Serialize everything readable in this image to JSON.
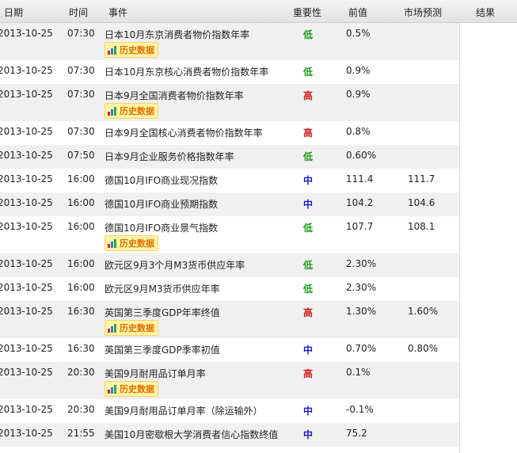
{
  "header": {
    "date": "日期",
    "time": "时间",
    "event": "事件",
    "importance": "重要性",
    "previous": "前值",
    "forecast": "市场预测",
    "result": "结果"
  },
  "history_label": "历史数据",
  "rows": [
    {
      "date": "2013-10-25",
      "time": "07:30",
      "event": "日本10月东京消费者物价指数年率",
      "importance": "低",
      "level": "low",
      "previous": "0.5%",
      "forecast": "",
      "result": "",
      "history": true
    },
    {
      "date": "2013-10-25",
      "time": "07:30",
      "event": "日本10月东京核心消费者物价指数年率",
      "importance": "低",
      "level": "low",
      "previous": "0.9%",
      "forecast": "",
      "result": "",
      "history": false
    },
    {
      "date": "2013-10-25",
      "time": "07:30",
      "event": "日本9月全国消费者物价指数年率",
      "importance": "高",
      "level": "high",
      "previous": "0.9%",
      "forecast": "",
      "result": "",
      "history": true
    },
    {
      "date": "2013-10-25",
      "time": "07:30",
      "event": "日本9月全国核心消费者物价指数年率",
      "importance": "高",
      "level": "high",
      "previous": "0.8%",
      "forecast": "",
      "result": "",
      "history": false
    },
    {
      "date": "2013-10-25",
      "time": "07:50",
      "event": "日本9月企业服务价格指数年率",
      "importance": "低",
      "level": "low",
      "previous": "0.60%",
      "forecast": "",
      "result": "",
      "history": false
    },
    {
      "date": "2013-10-25",
      "time": "16:00",
      "event": "德国10月IFO商业现况指数",
      "importance": "中",
      "level": "mid",
      "previous": "111.4",
      "forecast": "111.7",
      "result": "",
      "history": false
    },
    {
      "date": "2013-10-25",
      "time": "16:00",
      "event": "德国10月IFO商业预期指数",
      "importance": "中",
      "level": "mid",
      "previous": "104.2",
      "forecast": "104.6",
      "result": "",
      "history": false
    },
    {
      "date": "2013-10-25",
      "time": "16:00",
      "event": "德国10月IFO商业景气指数",
      "importance": "低",
      "level": "low",
      "previous": "107.7",
      "forecast": "108.1",
      "result": "",
      "history": true
    },
    {
      "date": "2013-10-25",
      "time": "16:00",
      "event": "欧元区9月3个月M3货币供应年率",
      "importance": "低",
      "level": "low",
      "previous": "2.30%",
      "forecast": "",
      "result": "",
      "history": false
    },
    {
      "date": "2013-10-25",
      "time": "16:00",
      "event": "欧元区9月M3货币供应年率",
      "importance": "低",
      "level": "low",
      "previous": "2.30%",
      "forecast": "",
      "result": "",
      "history": false
    },
    {
      "date": "2013-10-25",
      "time": "16:30",
      "event": "英国第三季度GDP年率终值",
      "importance": "高",
      "level": "high",
      "previous": "1.30%",
      "forecast": "1.60%",
      "result": "",
      "history": true
    },
    {
      "date": "2013-10-25",
      "time": "16:30",
      "event": "英国第三季度GDP季率初值",
      "importance": "中",
      "level": "mid",
      "previous": "0.70%",
      "forecast": "0.80%",
      "result": "",
      "history": false
    },
    {
      "date": "2013-10-25",
      "time": "20:30",
      "event": "美国9月耐用品订单月率",
      "importance": "高",
      "level": "high",
      "previous": "0.1%",
      "forecast": "",
      "result": "",
      "history": true
    },
    {
      "date": "2013-10-25",
      "time": "20:30",
      "event": "美国9月耐用品订单月率（除运输外）",
      "importance": "中",
      "level": "mid",
      "previous": "-0.1%",
      "forecast": "",
      "result": "",
      "history": false
    },
    {
      "date": "2013-10-25",
      "time": "21:55",
      "event": "美国10月密歇根大学消费者信心指数终值",
      "importance": "中",
      "level": "mid",
      "previous": "75.2",
      "forecast": "",
      "result": "",
      "history": false
    }
  ]
}
